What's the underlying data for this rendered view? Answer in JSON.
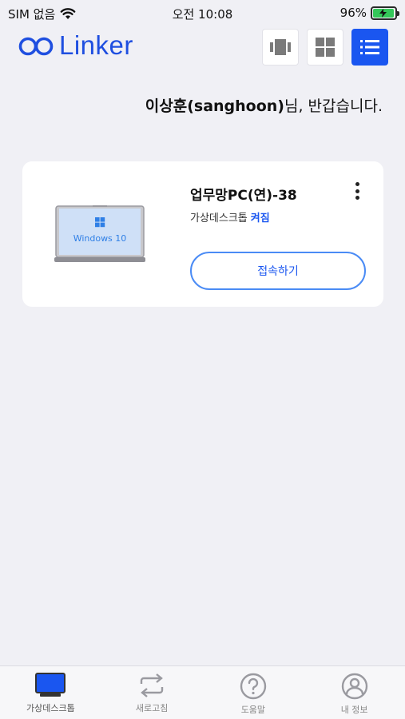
{
  "status_bar": {
    "carrier": "SIM 없음",
    "time": "오전 10:08",
    "battery": "96%",
    "battery_level": 0.96
  },
  "header": {
    "logo_text": "Linker",
    "brand_color": "#1f4fe0",
    "accent_color": "#1a56f0",
    "view_modes": [
      "carousel",
      "grid",
      "list"
    ],
    "active_view": "list"
  },
  "greeting": {
    "name": "이상훈(sanghoon)",
    "suffix": "님, 반갑습니다."
  },
  "desktops": [
    {
      "name": "업무망PC(연)-38",
      "type_label": "가상데스크톱",
      "state": "켜짐",
      "os_label": "Windows 10",
      "connect_label": "접속하기"
    }
  ],
  "tabbar": {
    "items": [
      {
        "label": "가상데스크톱",
        "icon": "monitor-icon",
        "active": true
      },
      {
        "label": "새로고침",
        "icon": "refresh-icon",
        "active": false
      },
      {
        "label": "도움말",
        "icon": "help-icon",
        "active": false
      },
      {
        "label": "내 정보",
        "icon": "user-icon",
        "active": false
      }
    ]
  }
}
